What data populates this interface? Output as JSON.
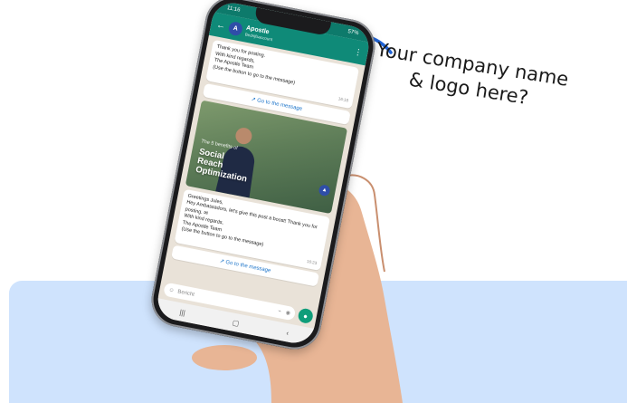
{
  "callout": {
    "line1": "Your company name",
    "line2": "& logo here?"
  },
  "colors": {
    "panel": "#cfe3fd",
    "whatsapp_header": "#0f8a78",
    "arrow": "#1f63d6",
    "link": "#1a73c9"
  },
  "phone": {
    "status_left": "11:16",
    "status_right": "57%",
    "chat_header": {
      "title": "Apostle",
      "subtitle": "Bedrijfsaccount"
    },
    "messages": [
      {
        "lines": [
          "Thank you for posting.",
          "With kind regards,",
          "The Apostle Team",
          "(Use the button to go to the message)"
        ],
        "time": "16:18"
      },
      {
        "lines": [
          "Greetings Jules,",
          "Hey Ambassadors, let's give this post a boost! Thank you for posting. ✉",
          "With kind regards,",
          "The Apostle Team",
          "(Use the button to go to the message)"
        ],
        "time": "16:23"
      }
    ],
    "link_button": "Go to the message",
    "media": {
      "overlay_small": "The 5 benefits of",
      "overlay_big_1": "Social",
      "overlay_big_2": "Reach",
      "overlay_big_3": "Optimization"
    },
    "input_placeholder": "Bericht",
    "nav": [
      "|||",
      "▢",
      "‹"
    ]
  }
}
